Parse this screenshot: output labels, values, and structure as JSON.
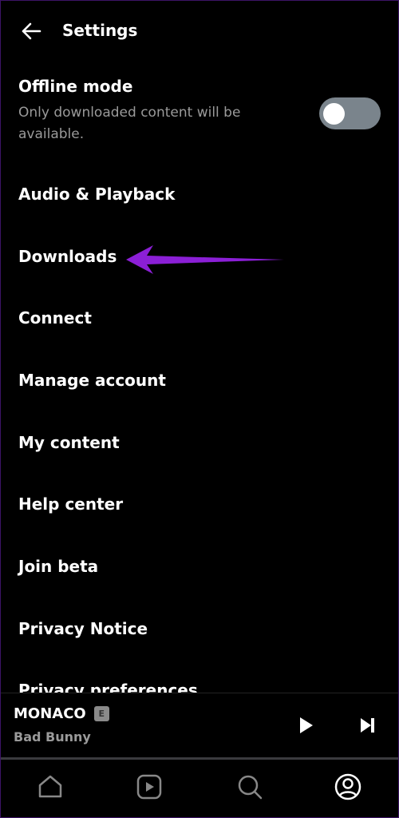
{
  "header": {
    "title": "Settings",
    "back_icon": "arrow-left-icon"
  },
  "offline_mode": {
    "title": "Offline mode",
    "subtitle": "Only downloaded content will be available.",
    "enabled": false
  },
  "items": [
    {
      "label": "Audio & Playback"
    },
    {
      "label": "Downloads"
    },
    {
      "label": "Connect"
    },
    {
      "label": "Manage account"
    },
    {
      "label": "My content"
    },
    {
      "label": "Help center"
    },
    {
      "label": "Join beta"
    },
    {
      "label": "Privacy Notice"
    },
    {
      "label": "Privacy preferences"
    }
  ],
  "annotation": {
    "color": "#8b1fd6",
    "points_to": "Downloads"
  },
  "player": {
    "song": "MONACO",
    "explicit_badge": "E",
    "artist": "Bad Bunny"
  },
  "nav": [
    {
      "icon": "home-icon",
      "active": false
    },
    {
      "icon": "video-icon",
      "active": false
    },
    {
      "icon": "search-icon",
      "active": false
    },
    {
      "icon": "profile-icon",
      "active": true
    }
  ]
}
